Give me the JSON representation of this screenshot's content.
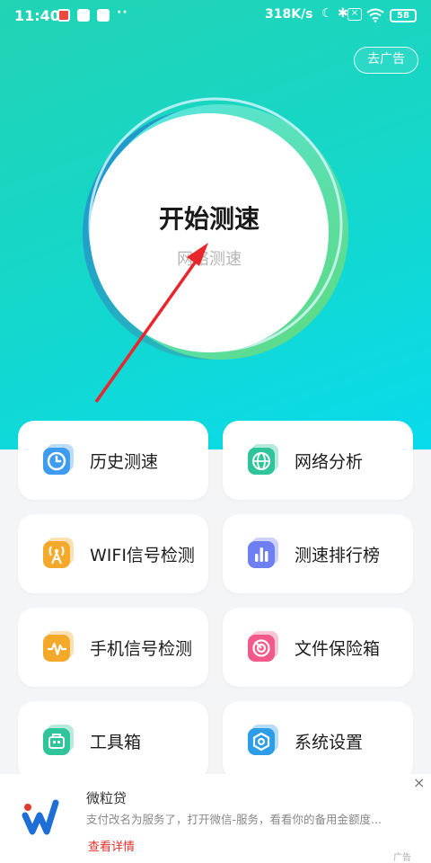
{
  "status_bar": {
    "time": "11:40",
    "dots": "··",
    "network_speed": "318K/s",
    "battery": "58"
  },
  "header": {
    "ad_button": "去广告"
  },
  "speed_test": {
    "title": "开始测速",
    "subtitle": "网络测速"
  },
  "features": [
    {
      "label": "历史测速",
      "icon": "history-clock-icon",
      "color": "#3d9bf0"
    },
    {
      "label": "网络分析",
      "icon": "globe-icon",
      "color": "#2fc49a"
    },
    {
      "label": "WIFI信号检测",
      "icon": "wifi-signal-icon",
      "color": "#f5a92b"
    },
    {
      "label": "测速排行榜",
      "icon": "bar-chart-icon",
      "color": "#6e7ff3"
    },
    {
      "label": "手机信号检测",
      "icon": "waveform-icon",
      "color": "#f5a92b"
    },
    {
      "label": "文件保险箱",
      "icon": "target-safe-icon",
      "color": "#f15a8a"
    },
    {
      "label": "工具箱",
      "icon": "toolbox-icon",
      "color": "#2fc49a"
    },
    {
      "label": "系统设置",
      "icon": "hex-settings-icon",
      "color": "#2d9de8"
    }
  ],
  "ad_banner": {
    "title": "微粒贷",
    "description": "支付改名为服务了，打开微信-服务，看看你的备用金额度...",
    "detail_link": "查看详情",
    "close": "×",
    "tag": "广告"
  },
  "colors": {
    "hero_start": "#22d3b4",
    "hero_end": "#08dbee",
    "arrow": "#e8262b"
  }
}
